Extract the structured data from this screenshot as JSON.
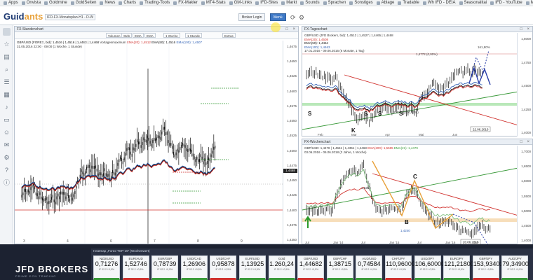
{
  "bookmarks": [
    "Apps",
    "Onvista",
    "Goldmine",
    "GoldSeiten",
    "News",
    "Charts",
    "Trading-Tools",
    "FX-Makler",
    "MT4-Stats",
    "GM-Links",
    "IFD-Sites",
    "Markt",
    "Sounds",
    "Sprachen",
    "Sonstiges",
    "Ablage",
    "Tradable",
    "Wh IFD - DEIA",
    "Seasonalitai",
    "IFD - YouTube",
    "Medien - mycom"
  ],
  "header": {
    "logo_main": "Guid",
    "logo_accent": "ants",
    "page_tab": "IFD-FX-Monatsplan-H1 - D-W",
    "broker_login": "Broker Login",
    "btn_blue": "Menü"
  },
  "left_panel": {
    "title": "FX-Stundenchart",
    "toolbar": [
      "Volumen",
      "Stdn",
      "EMA",
      "EMA",
      "1 Woche",
      "1 Stunde",
      "Extras"
    ],
    "legend_line1": "GBP/USD (FOREX, bid): 1,4516 | 1,4516 | 1,4463 | 1,4468",
    "legend_line2": "31.05.2016 22:00 - 09:00 (1 Woche, 1 Stunde)",
    "legend_vol": "Vortagesmaximum",
    "ema20": "EMA(20): 1,4512",
    "ema50": "EMA(50): 1,4516",
    "ema100": "EMA(100): 1,4507",
    "yticks": [
      "1,4675",
      "1,4650",
      "1,4625",
      "1,4600",
      "1,4575",
      "1,4550",
      "1,4525",
      "1,4500",
      "1,4475",
      "1,4450",
      "1,4425",
      "1,4400",
      "1,4375",
      "1,4350"
    ],
    "xticks": [
      "3",
      "4",
      "6",
      "7",
      "8",
      "9"
    ],
    "last_price": "1,4468"
  },
  "right_top_panel": {
    "title": "FX-Tageschart",
    "legend_line1": "GBP/USD (JFD Brokers, bid): 1,4512 | 1,4527 | 1,4465 | 1,4468",
    "ema20": "EMA(20): 1,4508",
    "ema50": "EMA(50): 1,4464",
    "ema100": "EMA(100): 1,4463",
    "legend_line3": "17.01.2016 - 09.06.2016 (6 Monate, 1 Tag)",
    "fib_top": "161,80%",
    "fib_mid": "1,4772 (0,00%)",
    "fib_low": "1,4022 (100,00%)",
    "labels": [
      "S",
      "S",
      "S",
      "S",
      "K"
    ],
    "yticks": [
      "1,5000",
      "1,4750",
      "1,4500",
      "1,4250",
      "1,4000"
    ],
    "xticks": [
      "Feb",
      "Mar",
      "Apr",
      "Mai",
      "Jun"
    ],
    "date_box": "22.06.2016"
  },
  "right_bottom_panel": {
    "title": "FX-Wochenchart",
    "legend_line1": "GBP/USD: 1,4478 | 1,4661 | 1,4351 | 1,4468",
    "legend_ema200": "EMA(200): 1,5585",
    "legend_ema21": "EMA(21): 1,4479",
    "legend_line2": "03.06.2016 - 06.06.2018 (3 Jahre, 1 Woche)",
    "labels": [
      "C",
      "B"
    ],
    "b_value": "1,4240",
    "level_value": "1,5253",
    "yticks": [
      "1,7000",
      "1,6500",
      "1,6000",
      "1,5500",
      "1,5000",
      "1,4500",
      "1,4000"
    ],
    "xticks": [
      "Jul",
      "Jan '14",
      "Jul",
      "Jan '15",
      "Jul",
      "Jan '16",
      "Jul"
    ],
    "date_box": "20.06.2016"
  },
  "heatmap": {
    "title": "Heatmap „Forex-TOP-15\" (Wochenwert)",
    "brand": "JFD BROKERS",
    "brand_sub": "PRIME ECN TRADING",
    "tiles": [
      {
        "name": "NZD/USD",
        "value": "0,71276",
        "sub": "IF 02.2 +0,5%"
      },
      {
        "name": "EUR/AUD",
        "value": "1,52746",
        "sub": "IF 02.2 +0,5%"
      },
      {
        "name": "EUR/GBP",
        "value": "0,78739",
        "sub": "IF 02.2 +0,5%"
      },
      {
        "name": "USD/CAD",
        "value": "1,26906",
        "sub": "IF 02.2 +0,5%"
      },
      {
        "name": "USD/CHF",
        "value": "0,95878",
        "sub": "IF 02.2 +0,5%"
      },
      {
        "name": "EUR/USD",
        "value": "1,13925",
        "sub": "IF 02.2 +0,5%"
      },
      {
        "name": "Gold",
        "value": "1.260,24",
        "sub": "IF 02.2 +0,5%"
      },
      {
        "name": "GBP/USD",
        "value": "1,44682",
        "sub": "IF 02.2 +0,5%"
      },
      {
        "name": "GBP/CHF",
        "value": "1,38715",
        "sub": "IF 02.2 +0,5%"
      },
      {
        "name": "AUD/USD",
        "value": "0,74584",
        "sub": "IF 02.2 +0,5%"
      },
      {
        "name": "CHF/JPY",
        "value": "110,96000",
        "sub": "IF 02.2 +0,5%"
      },
      {
        "name": "USD/JPY",
        "value": "106,60000",
        "sub": "IF 02.2 +0,5%"
      },
      {
        "name": "EUR/JPY",
        "value": "121,21800",
        "sub": "IF 02.2 +0,5%"
      },
      {
        "name": "GBP/JPY",
        "value": "153,93401",
        "sub": "IF 02.2 +0,5%"
      },
      {
        "name": "AUD/JPY",
        "value": "79,34900",
        "sub": "IF 02.2 +0,5%"
      }
    ]
  }
}
